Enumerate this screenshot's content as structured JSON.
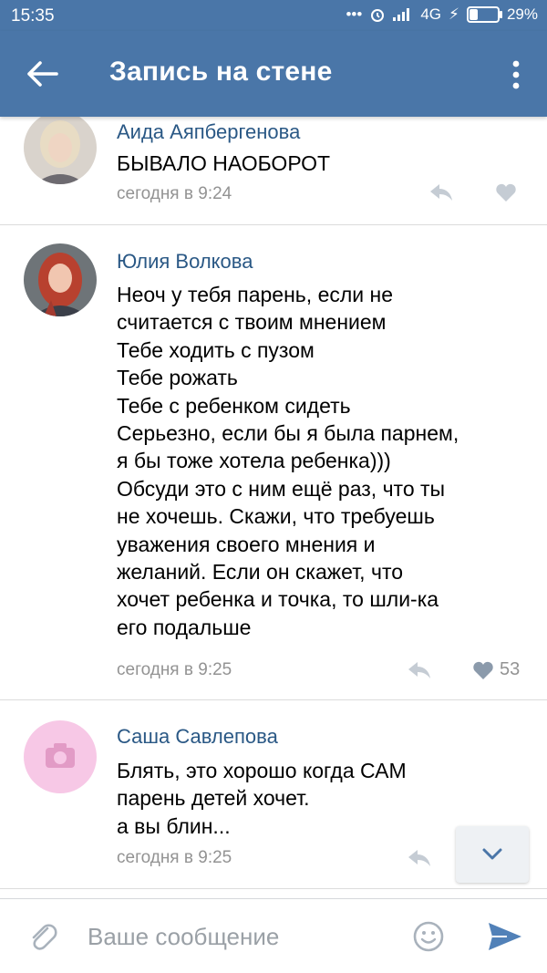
{
  "status_bar": {
    "time": "15:35",
    "network": "4G",
    "battery_percent_text": "29%",
    "battery_level": 0.29
  },
  "app_bar": {
    "title": "Запись на стене"
  },
  "comments": [
    {
      "author": "Аида Аяпбергенова",
      "text": "БЫВАЛО НАОБОРОТ",
      "time": "сегодня в 9:24",
      "likes": ""
    },
    {
      "author": "Юлия Волкова",
      "text": "Неоч у тебя парень, если не\nсчитается с твоим мнением\nТебе ходить с пузом\nТебе рожать\nТебе с ребенком сидеть\nСерьезно, если бы я была парнем,\nя бы тоже хотела ребенка)))\nОбсуди это с ним ещё раз, что ты\nне хочешь. Скажи, что требуешь\nуважения своего мнения и\nжеланий. Если он скажет, что\nхочет ребенка и точка, то шли-ка\nего подальше",
      "time": "сегодня в 9:25",
      "likes": "53"
    },
    {
      "author": "Саша Савлепова",
      "text": "Блять, это хорошо когда САМ\nпарень детей хочет.\nа вы блин...",
      "time": "сегодня в 9:25",
      "likes": ""
    }
  ],
  "compose": {
    "placeholder": "Ваше сообщение"
  },
  "colors": {
    "header": "#4a76a8",
    "author": "#2a5885",
    "meta": "#939393"
  },
  "icons": [
    "back-arrow-icon",
    "more-vertical-icon",
    "reply-icon",
    "heart-icon",
    "camera-icon",
    "chevron-down-icon",
    "paperclip-icon",
    "smile-icon",
    "send-icon"
  ]
}
